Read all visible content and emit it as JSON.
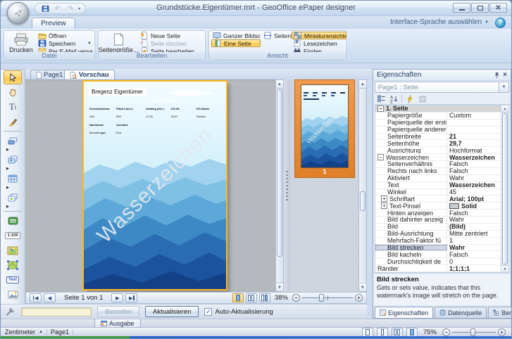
{
  "titlebar": {
    "title": "Grundstücke.Eigentümer.mrt - GeoOffice ePaper designer"
  },
  "ribbon_tab": "Preview",
  "language_selector": "Interface-Sprache auswählen",
  "ribbon": {
    "datei": {
      "label": "Datei",
      "drucken": "Drucken",
      "oeffnen": "Öffnen",
      "speichern": "Speichern",
      "email": "Per E-Mail versend..."
    },
    "bearbeiten": {
      "label": "Bearbeiten",
      "seitengroesse": "Seitengröße...",
      "neue_seite": "Neue Seite",
      "seite_loeschen": "Seite löschen",
      "seite_bearbeiten": "Seite bearbeiten..."
    },
    "ansicht": {
      "label": "Ansicht",
      "ganzer_bildschirm": "Ganzer Bildschi...",
      "eine_seite": "Eine Seite",
      "seitenbreite": "Seitenbreite",
      "miniaturansichten": "Miniaturansichten",
      "lesezeichen": "Lesezeichen",
      "finden": "Finden"
    }
  },
  "doc_tabs": {
    "page1": "Page1",
    "vorschau": "Vorschau"
  },
  "document": {
    "title": "Bregenz Eigentümer",
    "watermark": "Wasserzeichen",
    "table": {
      "headers": [
        "Grundstücksnr.",
        "Fläche (ber.)",
        "Umfang (ber.)",
        "KG-Nr.",
        "KG-Name"
      ],
      "values": [
        "400",
        "999",
        "17,26",
        "5119",
        "Reuthe"
      ],
      "headers2": [
        "Nachname",
        "Vorname"
      ],
      "values2": [
        "Moosbrugger",
        "Eva"
      ]
    }
  },
  "thumbnail": {
    "page_number": "1"
  },
  "preview_nav": {
    "page_label": "Seite 1 von 1",
    "zoom_value": "38%"
  },
  "update_bar": {
    "beenden": "Beenden",
    "aktualisieren": "Aktualisieren",
    "auto_update": "Auto-Aktualisierung"
  },
  "properties": {
    "title": "Eigenschaften",
    "selector": "Page1 : Seite",
    "rows": [
      {
        "name": "1. Seite",
        "value": "",
        "cat": true,
        "expand": "minus"
      },
      {
        "name": "Papiergröße",
        "value": "Custom",
        "indent": 1
      },
      {
        "name": "Papierquelle der erste",
        "value": "",
        "indent": 1
      },
      {
        "name": "Papierquelle anderer S",
        "value": "",
        "indent": 1
      },
      {
        "name": "Seitenbreite",
        "value": "21",
        "bold": true,
        "indent": 1
      },
      {
        "name": "Seitenhöhe",
        "value": "29,7",
        "bold": true,
        "indent": 1
      },
      {
        "name": "Ausrichtung",
        "value": "Hochformat",
        "indent": 1
      },
      {
        "name": "Wasserzeichen",
        "value": "Wasserzeichen",
        "bold": true,
        "expand": "minus"
      },
      {
        "name": "Seitenverhältnis",
        "value": "Falsch",
        "indent": 1
      },
      {
        "name": "Rechts nach links",
        "value": "Falsch",
        "indent": 1
      },
      {
        "name": "Aktiviert",
        "value": "Wahr",
        "indent": 1
      },
      {
        "name": "Text",
        "value": "Wasserzeichen",
        "bold": true,
        "indent": 1
      },
      {
        "name": "Winkel",
        "value": "45",
        "indent": 1
      },
      {
        "name": "Schriftart",
        "value": "Arial; 100pt",
        "bold": true,
        "expand": "plus",
        "indent": 1
      },
      {
        "name": "Text-Pinsel",
        "value": "Solid",
        "bold": true,
        "expand": "plus",
        "indent": 1,
        "swatch": true
      },
      {
        "name": "Hinten anzeigen",
        "value": "Falsch",
        "indent": 1
      },
      {
        "name": "Bild dahinter anzeig",
        "value": "Wahr",
        "indent": 1
      },
      {
        "name": "Bild",
        "value": "(Bild)",
        "bold": true,
        "indent": 1
      },
      {
        "name": "Bild-Ausrichtung",
        "value": "Mitte zentriert",
        "indent": 1
      },
      {
        "name": "Mehrfach-Faktor fü",
        "value": "1",
        "indent": 1
      },
      {
        "name": "Bild strecken",
        "value": "Wahr",
        "bold": true,
        "indent": 1,
        "selected": true
      },
      {
        "name": "Bild kacheln",
        "value": "Falsch",
        "indent": 1
      },
      {
        "name": "Durchsichtigkeit de",
        "value": "0",
        "indent": 1
      },
      {
        "name": "Ränder",
        "value": "1;1;1;1",
        "bold": true
      }
    ],
    "description": {
      "title": "Bild strecken",
      "text": "Gets or sets value, indicates that this watermark's image will stretch on the page."
    },
    "tabs": [
      "Eigenschaften",
      "Datenquelle",
      "Berichtsbaum"
    ]
  },
  "output_tab": "Ausgabe",
  "statusbar": {
    "units": "Zentimeter",
    "page": "Page1",
    "zoom_value": "75%"
  },
  "colors": {
    "accent_orange": "#ffc848",
    "watermark_gray": "#e3e8ee",
    "selection_orange": "#e07f28"
  }
}
